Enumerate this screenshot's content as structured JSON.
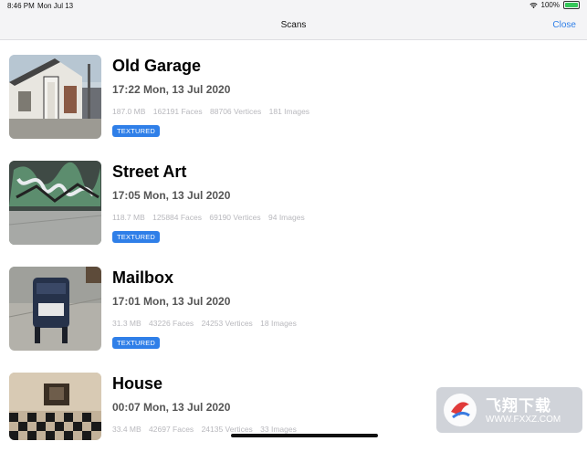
{
  "status_bar": {
    "time": "8:46 PM",
    "date": "Mon Jul 13",
    "battery": "100%"
  },
  "nav": {
    "title": "Scans",
    "close_label": "Close"
  },
  "scans": [
    {
      "title": "Old Garage",
      "date": "17:22 Mon, 13 Jul 2020",
      "size": "187.0 MB",
      "faces": "162191 Faces",
      "vertices": "88706 Vertices",
      "images": "181 Images",
      "badge": "TEXTURED"
    },
    {
      "title": "Street Art",
      "date": "17:05 Mon, 13 Jul 2020",
      "size": "118.7 MB",
      "faces": "125884 Faces",
      "vertices": "69190 Vertices",
      "images": "94 Images",
      "badge": "TEXTURED"
    },
    {
      "title": "Mailbox",
      "date": "17:01 Mon, 13 Jul 2020",
      "size": "31.3 MB",
      "faces": "43226 Faces",
      "vertices": "24253 Vertices",
      "images": "18 Images",
      "badge": "TEXTURED"
    },
    {
      "title": "House",
      "date": "00:07 Mon, 13 Jul 2020",
      "size": "33.4 MB",
      "faces": "42697 Faces",
      "vertices": "24135 Vertices",
      "images": "33 Images"
    }
  ],
  "watermark": {
    "text": "飞翔下载",
    "url": "WWW.FXXZ.COM"
  },
  "colors": {
    "accent": "#2f7fe8",
    "badge_bg": "#2f7fe8",
    "meta_text": "#b8b8bd"
  }
}
